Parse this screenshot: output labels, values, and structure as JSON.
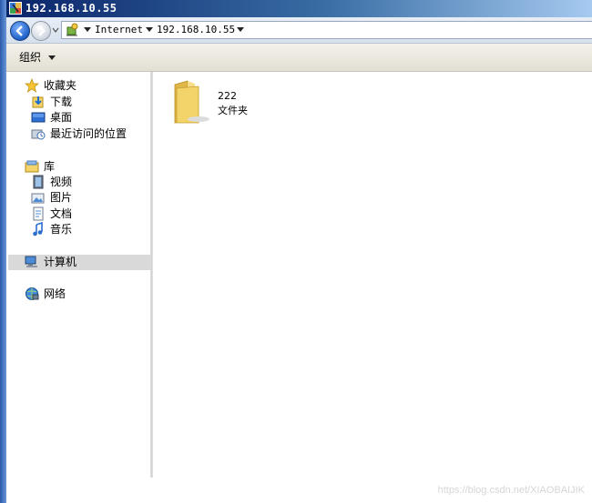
{
  "window": {
    "title": "192.168.10.55"
  },
  "address": {
    "crumbs": [
      {
        "label": "Internet"
      },
      {
        "label": "192.168.10.55"
      }
    ]
  },
  "toolbar": {
    "organize_label": "组织"
  },
  "nav": {
    "favorites": {
      "label": "收藏夹",
      "items": [
        {
          "label": "下载",
          "icon": "download-folder-icon"
        },
        {
          "label": "桌面",
          "icon": "desktop-icon"
        },
        {
          "label": "最近访问的位置",
          "icon": "recent-places-icon"
        }
      ]
    },
    "libraries": {
      "label": "库",
      "items": [
        {
          "label": "视频",
          "icon": "video-library-icon"
        },
        {
          "label": "图片",
          "icon": "pictures-library-icon"
        },
        {
          "label": "文档",
          "icon": "documents-library-icon"
        },
        {
          "label": "音乐",
          "icon": "music-library-icon"
        }
      ]
    },
    "computer": {
      "label": "计算机"
    },
    "network": {
      "label": "网络"
    }
  },
  "content": {
    "items": [
      {
        "name": "222",
        "type": "文件夹",
        "icon": "folder-icon"
      }
    ]
  },
  "watermark": "https://blog.csdn.net/XIAOBAIJIK",
  "colors": {
    "title_bar_start": "#0a246a",
    "title_bar_end": "#a6caf0",
    "selected_nav": "#d9d9d9",
    "folder_yellow": "#f3d46b"
  }
}
